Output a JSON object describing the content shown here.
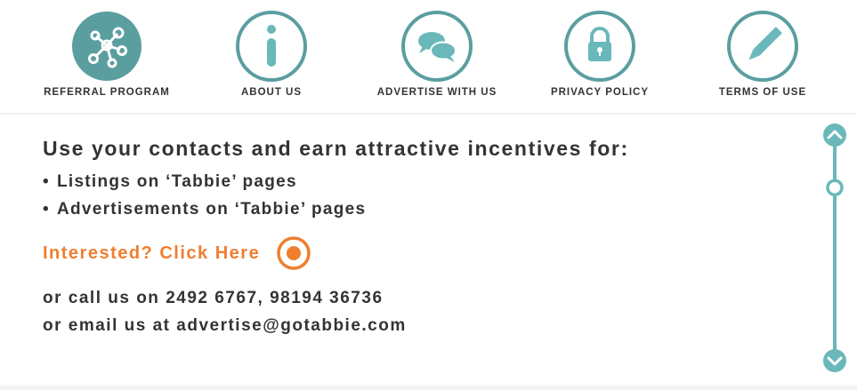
{
  "colors": {
    "teal": "#5a9ea0",
    "teal_light": "#6ab8ba",
    "orange": "#ef7e2f",
    "text": "#333333"
  },
  "nav": {
    "items": [
      {
        "label": "REFERRAL PROGRAM",
        "icon": "network-icon",
        "active": true
      },
      {
        "label": "ABOUT US",
        "icon": "info-icon",
        "active": false
      },
      {
        "label": "ADVERTISE WITH US",
        "icon": "chat-bubbles-icon",
        "active": false
      },
      {
        "label": "PRIVACY POLICY",
        "icon": "lock-icon",
        "active": false
      },
      {
        "label": "TERMS OF USE",
        "icon": "pencil-icon",
        "active": false
      }
    ]
  },
  "main": {
    "headline": "Use your contacts and earn attractive incentives for:",
    "bullets": [
      "Listings on ‘Tabbie’ pages",
      "Advertisements on ‘Tabbie’ pages"
    ],
    "cta_label": "Interested? Click Here",
    "contact": {
      "phone_line": "or call us on 2492 6767, 98194 36736",
      "email_line": "or email us at advertise@gotabbie.com"
    }
  },
  "scroller": {
    "up_icon": "chevron-up-icon",
    "down_icon": "chevron-down-icon",
    "position": 0.2
  }
}
